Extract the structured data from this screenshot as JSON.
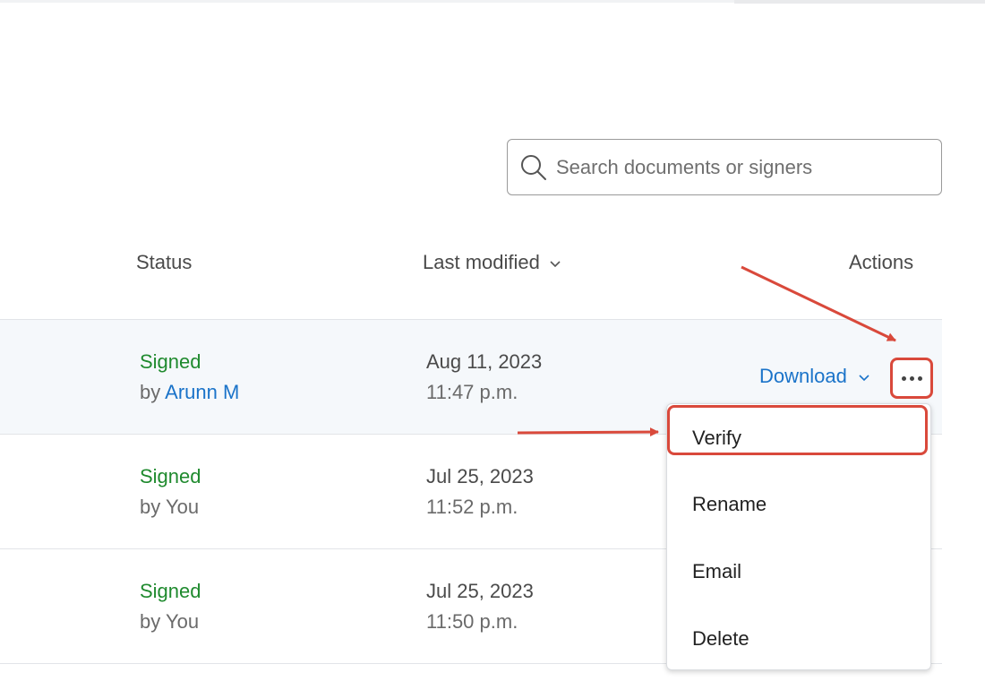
{
  "search": {
    "placeholder": "Search documents or signers",
    "value": ""
  },
  "table": {
    "headers": {
      "status": "Status",
      "last_modified": "Last modified",
      "actions": "Actions"
    },
    "rows": [
      {
        "status": "Signed",
        "by_prefix": "by",
        "signer": "Arunn M",
        "date": "Aug 11, 2023",
        "time": "11:47 p.m.",
        "download_label": "Download"
      },
      {
        "status": "Signed",
        "by_prefix": "by",
        "signer": "You",
        "date": "Jul 25, 2023",
        "time": "11:52 p.m."
      },
      {
        "status": "Signed",
        "by_prefix": "by",
        "signer": "You",
        "date": "Jul 25, 2023",
        "time": "11:50 p.m."
      }
    ]
  },
  "menu": {
    "items": [
      "Verify",
      "Rename",
      "Email",
      "Delete"
    ]
  },
  "icons": {
    "search": "search-icon",
    "sort": "chevron-down-icon",
    "download_dropdown": "chevron-down-icon",
    "more": "more-horizontal-icon"
  },
  "colors": {
    "signed_status": "#1f8a2e",
    "link": "#1a73c9",
    "annotation": "#d9493b",
    "row_highlight": "#f5f8fb"
  }
}
